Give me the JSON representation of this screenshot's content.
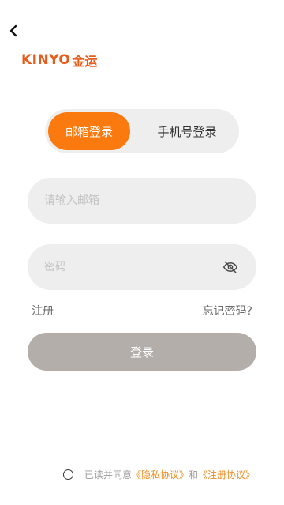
{
  "header": {
    "back_icon": "chevron-left-icon",
    "logo_latin": "KINYO",
    "logo_cjk": "金运",
    "brand_color": "#e85c1b"
  },
  "tabs": {
    "email_label": "邮箱登录",
    "phone_label": "手机号登录",
    "active": "email",
    "active_color": "#fa7a0f"
  },
  "form": {
    "email_placeholder": "请输入邮箱",
    "password_placeholder": "密码",
    "eye_icon": "eye-off-icon"
  },
  "links": {
    "register": "注册",
    "forgot": "忘记密码?"
  },
  "login_button": {
    "label": "登录",
    "color": "#b3aeaa"
  },
  "agreement": {
    "checked": false,
    "prefix": "已读并同意",
    "privacy": "《隐私协议》",
    "and": "和",
    "register": "《注册协议》",
    "link_color": "#f08a1c"
  }
}
